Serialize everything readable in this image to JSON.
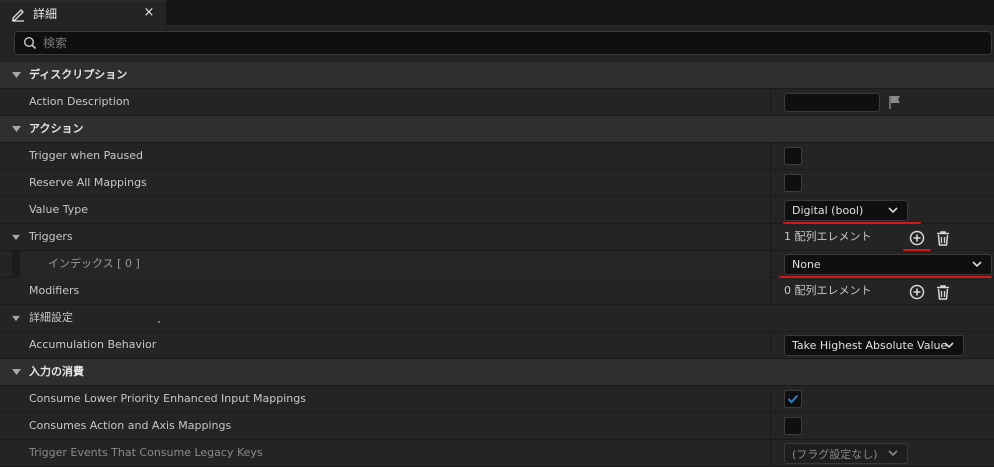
{
  "tab": {
    "title": "詳細",
    "icon": "pencil-icon",
    "close": "×"
  },
  "search": {
    "placeholder": "検索",
    "value": ""
  },
  "categories": {
    "description": {
      "label": "ディスクリプション"
    },
    "action": {
      "label": "アクション"
    },
    "advanced": {
      "label": "詳細設定"
    },
    "consume": {
      "label": "入力の消費"
    }
  },
  "properties": {
    "action_description": {
      "label": "Action Description",
      "value": ""
    },
    "trigger_when_paused": {
      "label": "Trigger when Paused",
      "checked": false
    },
    "reserve_all_mappings": {
      "label": "Reserve All Mappings",
      "checked": false
    },
    "value_type": {
      "label": "Value Type",
      "value": "Digital (bool)"
    },
    "triggers": {
      "label": "Triggers",
      "count": "1 配列エレメント"
    },
    "trigger_index": {
      "label": "インデックス [ 0 ]",
      "value": "None"
    },
    "modifiers": {
      "label": "Modifiers",
      "count": "0 配列エレメント"
    },
    "accumulation_behavior": {
      "label": "Accumulation Behavior",
      "value": "Take Highest Absolute Value"
    },
    "consume_lower_priority": {
      "label": "Consume Lower Priority Enhanced Input Mappings",
      "checked": true
    },
    "consumes_action_axis": {
      "label": "Consumes Action and Axis Mappings",
      "checked": false
    },
    "trigger_events_legacy": {
      "label": "Trigger Events That Consume Legacy Keys",
      "value": "(フラグ設定なし)"
    }
  },
  "colors": {
    "accent": "#2f7fd6",
    "annotation": "#d01818",
    "panel": "#242424",
    "category": "#2f2f2f"
  }
}
